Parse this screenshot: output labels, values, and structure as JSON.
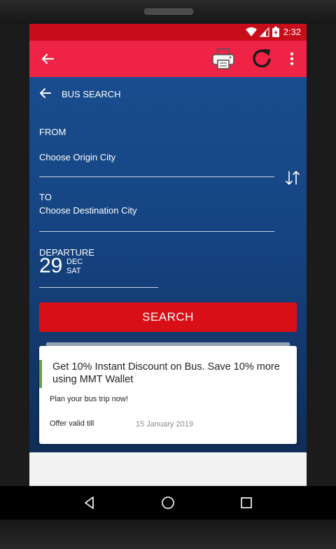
{
  "status_bar": {
    "time": "2:32"
  },
  "toolbar": {
    "back_icon": "arrow-left-icon",
    "print_icon": "printer-icon",
    "refresh_icon": "refresh-icon",
    "more_icon": "more-vertical-icon"
  },
  "bus_search": {
    "title": "BUS SEARCH",
    "from_label": "FROM",
    "from_placeholder": "Choose Origin City",
    "to_label": "TO",
    "to_placeholder": "Choose Destination City",
    "departure_label": "DEPARTURE",
    "departure_day": "29",
    "departure_month": "DEC",
    "departure_weekday": "SAT",
    "search_button": "SEARCH"
  },
  "offer": {
    "title": "Get 10% Instant Discount on Bus. Save 10% more using MMT Wallet",
    "subtitle": "Plan your bus trip now!",
    "valid_label": "Offer valid till",
    "valid_date": "15 January 2019"
  },
  "colors": {
    "status_bar": "#c70d1a",
    "toolbar": "#ee2345",
    "search_button": "#d80f16",
    "offer_accent": "#6a9e47"
  }
}
